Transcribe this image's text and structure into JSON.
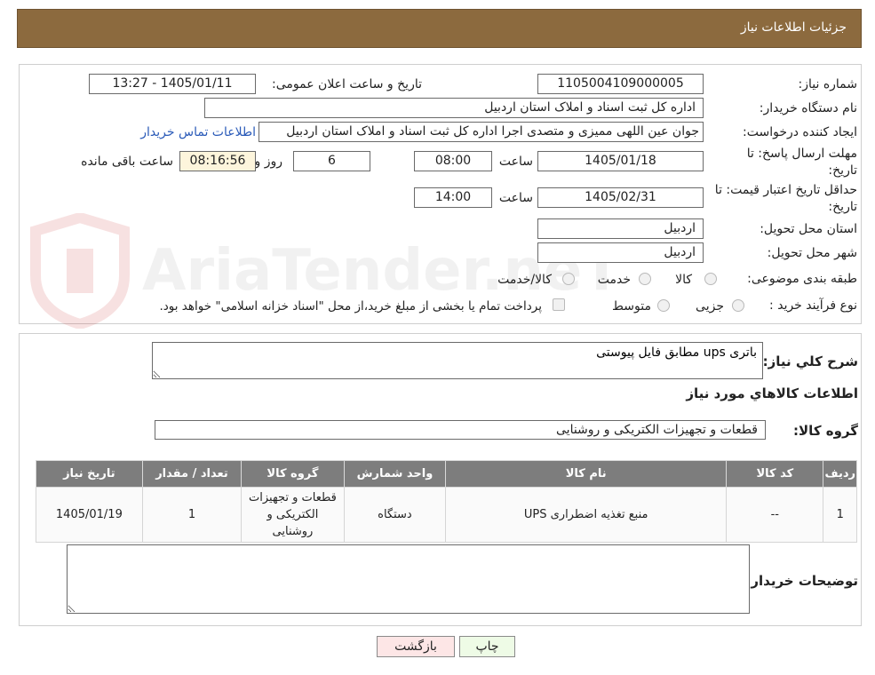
{
  "header": {
    "title": "جزئیات اطلاعات نیاز"
  },
  "form": {
    "need_number_label": "شماره نیاز:",
    "need_number": "1105004109000005",
    "announce_label": "تاریخ و ساعت اعلان عمومی:",
    "announce_value": "1405/01/11 - 13:27",
    "buyer_org_label": "نام دستگاه خریدار:",
    "buyer_org": "اداره کل ثبت اسناد و املاک استان اردبیل",
    "creator_label": "ایجاد کننده درخواست:",
    "creator": "جوان  عین اللهی ممیزی و متصدی اجرا اداره کل ثبت اسناد و املاک استان اردبیل",
    "contact_link": "اطلاعات تماس خریدار",
    "deadline_label_line1": "مهلت ارسال پاسخ: تا",
    "deadline_label_line2": "تاریخ:",
    "deadline_date": "1405/01/18",
    "time_label": "ساعت",
    "deadline_time": "08:00",
    "days_value": "6",
    "days_label": "روز و",
    "remaining_time": "08:16:56",
    "remaining_label": "ساعت باقی مانده",
    "validity_label_line1": "حداقل تاریخ اعتبار قیمت: تا",
    "validity_label_line2": "تاریخ:",
    "validity_date": "1405/02/31",
    "validity_time": "14:00",
    "province_label": "استان محل تحویل:",
    "province": "اردبیل",
    "city_label": "شهر محل تحویل:",
    "city": "اردبیل",
    "category_label": "طبقه بندی موضوعی:",
    "category_options": [
      "کالا",
      "خدمت",
      "کالا/خدمت"
    ],
    "process_label": "نوع فرآیند خرید :",
    "process_options": [
      "جزیی",
      "متوسط"
    ],
    "payment_note": "پرداخت تمام یا بخشی از مبلغ خرید،از محل \"اسناد خزانه اسلامی\" خواهد بود."
  },
  "details": {
    "description_label": "شرح کلي نياز:",
    "description": "باتری ups مطابق فایل پیوستی",
    "goods_info_title": "اطلاعات کالاهاي مورد نياز",
    "goods_group_label": "گروه کالا:",
    "goods_group": "قطعات و تجهیزات الکتریکی و روشنایی",
    "table": {
      "headers": [
        "رديف",
        "کد کالا",
        "نام کالا",
        "واحد شمارش",
        "گروه کالا",
        "تعداد / مقدار",
        "تاريخ نياز"
      ],
      "rows": [
        [
          "1",
          "--",
          "منبع تغذیه اضطراری UPS",
          "دستگاه",
          "قطعات و تجهیزات الکتریکی و روشنایی",
          "1",
          "1405/01/19"
        ]
      ]
    },
    "buyer_notes_label": "توضیحات خریدار:",
    "buyer_notes": ""
  },
  "buttons": {
    "print": "چاپ",
    "back": "بازگشت"
  },
  "watermark": {
    "text": "AriaTender.neT"
  },
  "colors": {
    "header_bg": "#8c6a3e",
    "table_header_bg": "#7d7d7d",
    "remaining_bg": "#fdf5dc",
    "print_bg": "#eefbe6",
    "back_bg": "#fde6e6",
    "link": "#2a5ab8"
  }
}
